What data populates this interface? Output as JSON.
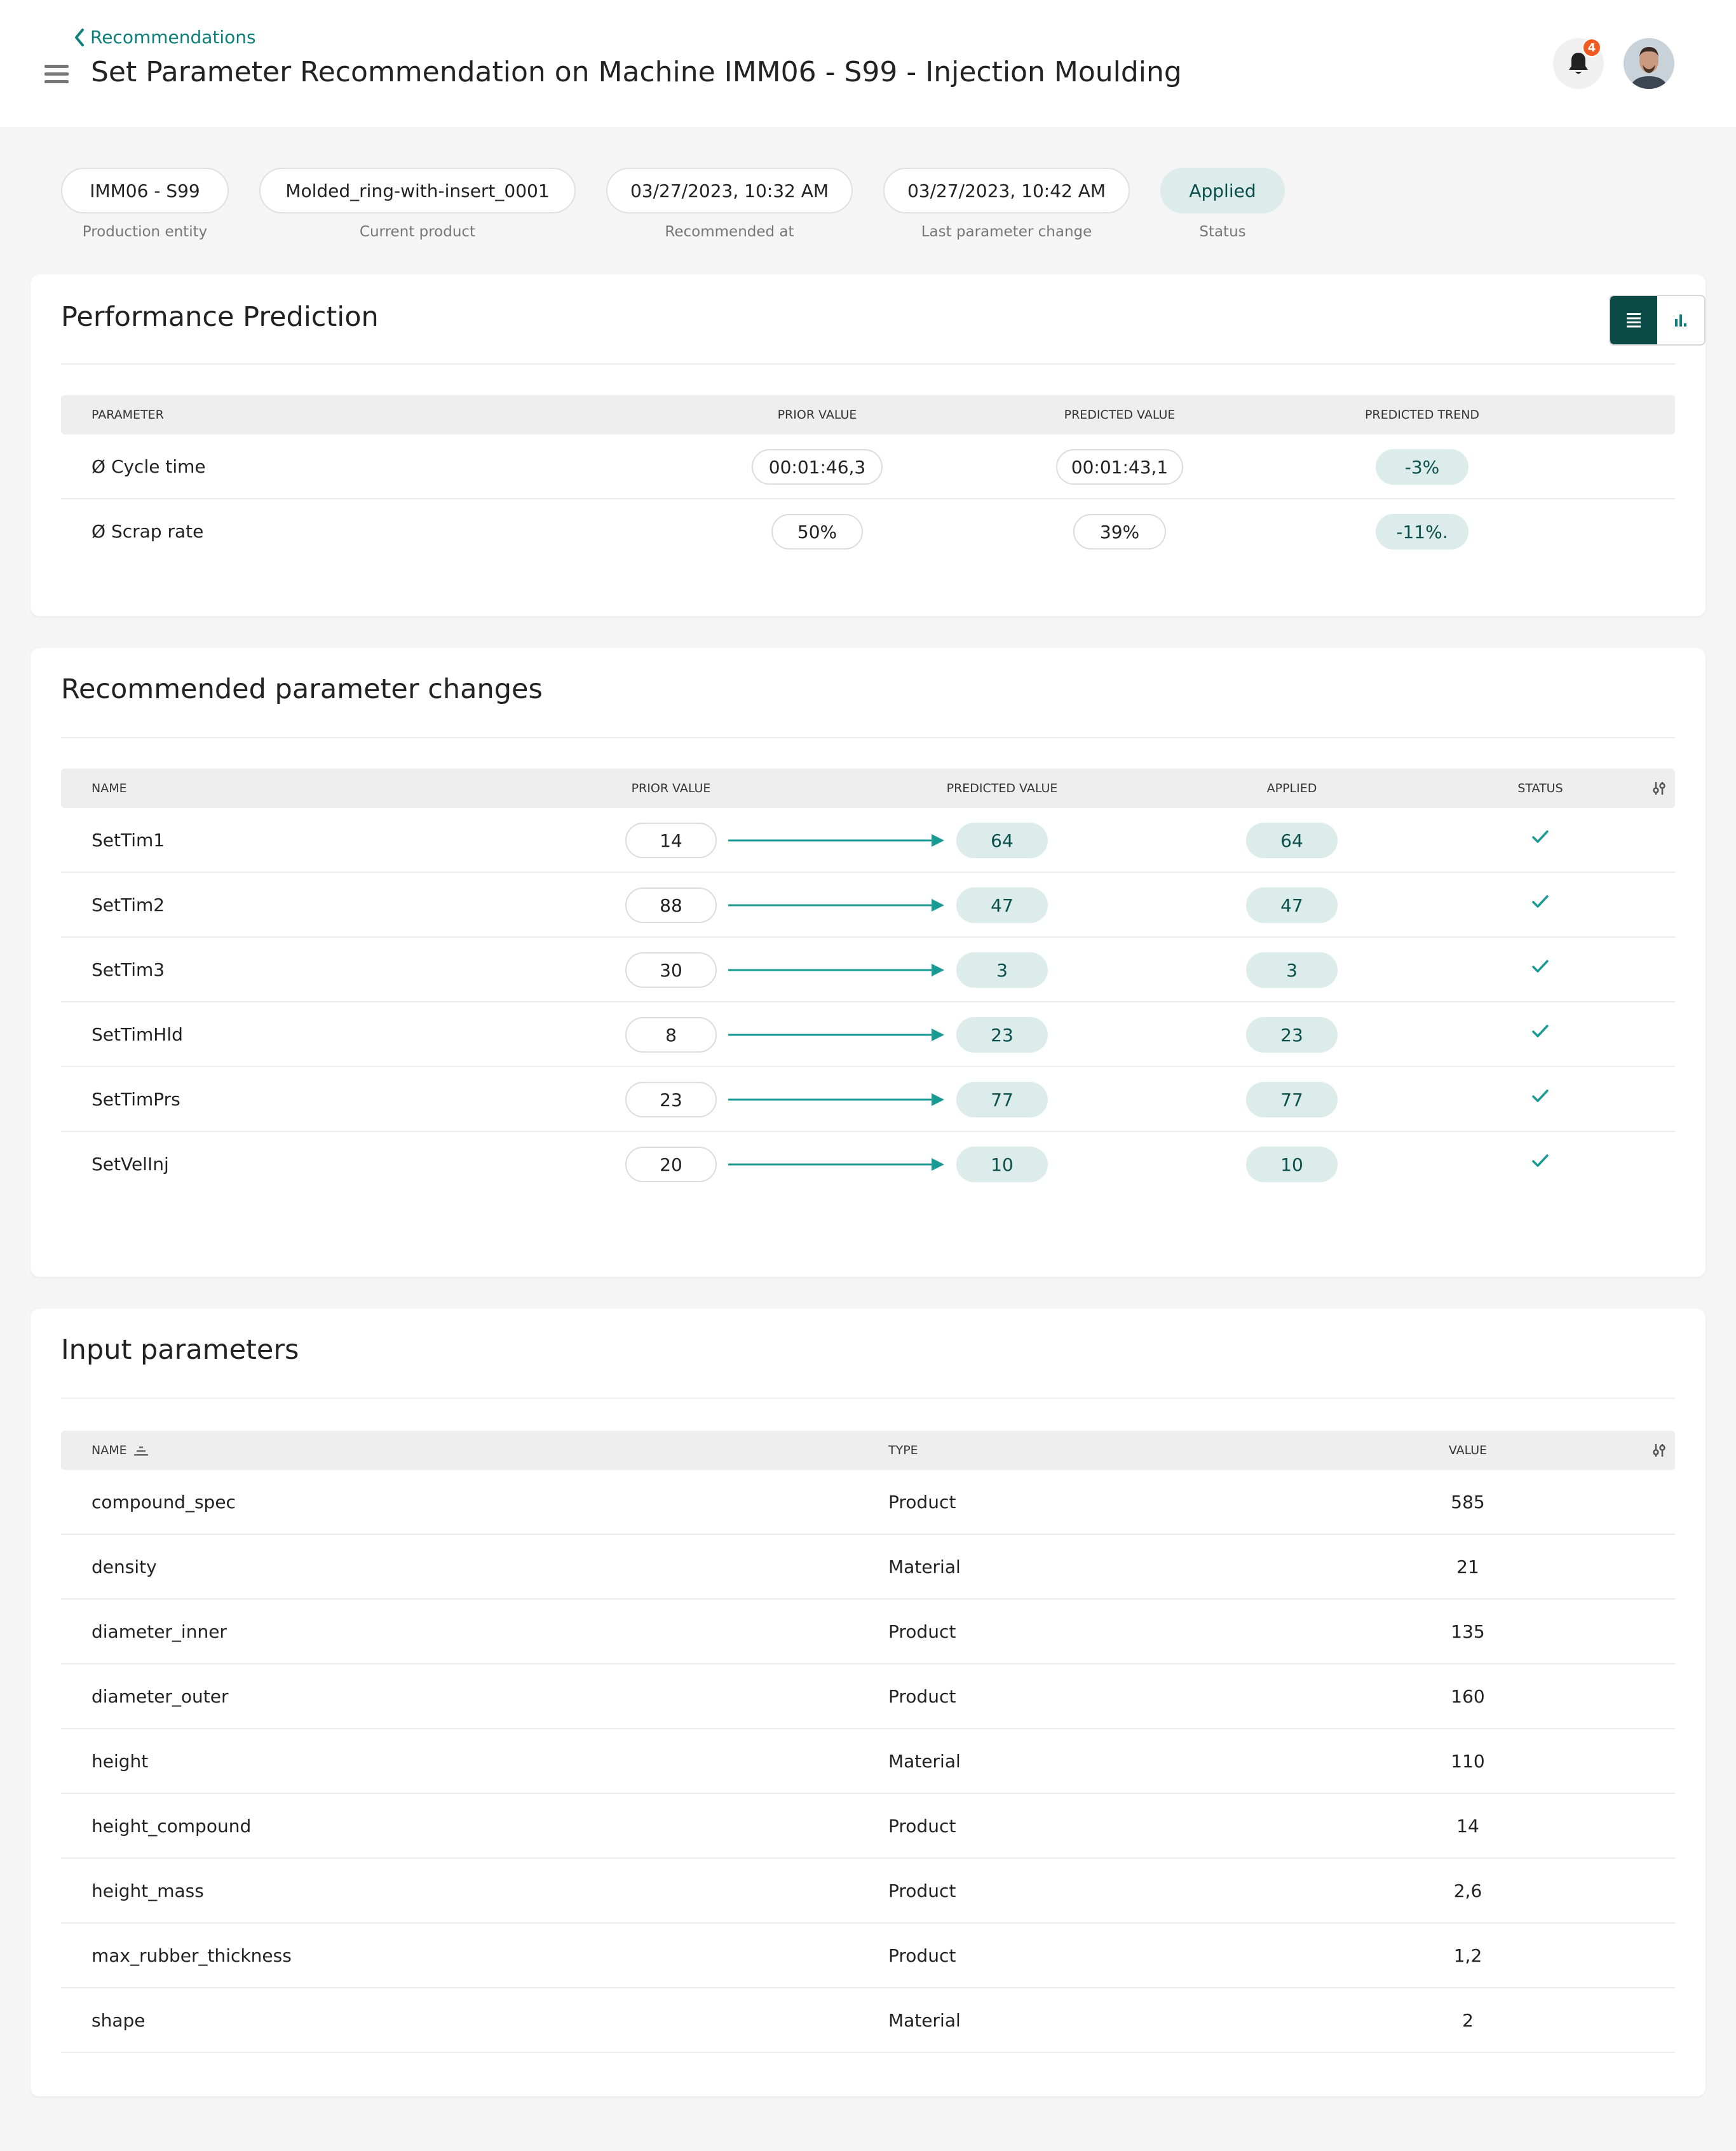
{
  "header": {
    "back_label": "Recommendations",
    "title": "Set Parameter Recommendation on Machine IMM06 - S99 - Injection Moulding",
    "notification_count": "4"
  },
  "info": [
    {
      "value": "IMM06 - S99",
      "label": "Production entity"
    },
    {
      "value": "Molded_ring-with-insert_0001",
      "label": "Current product"
    },
    {
      "value": "03/27/2023, 10:32 AM",
      "label": "Recommended at"
    },
    {
      "value": "03/27/2023, 10:42 AM",
      "label": "Last parameter change"
    },
    {
      "value": "Applied",
      "label": "Status"
    }
  ],
  "performance": {
    "title": "Performance Prediction",
    "columns": [
      "PARAMETER",
      "PRIOR VALUE",
      "PREDICTED VALUE",
      "PREDICTED TREND"
    ],
    "rows": [
      {
        "parameter": "Ø Cycle time",
        "prior": "00:01:46,3",
        "predicted": "00:01:43,1",
        "trend": "-3%"
      },
      {
        "parameter": "Ø Scrap rate",
        "prior": "50%",
        "predicted": "39%",
        "trend": "-11%."
      }
    ]
  },
  "recommended": {
    "title": "Recommended parameter changes",
    "columns": [
      "NAME",
      "PRIOR VALUE",
      "PREDICTED VALUE",
      "APPLIED",
      "STATUS"
    ],
    "rows": [
      {
        "name": "SetTim1",
        "prior": "14",
        "predicted": "64",
        "applied": "64"
      },
      {
        "name": "SetTim2",
        "prior": "88",
        "predicted": "47",
        "applied": "47"
      },
      {
        "name": "SetTim3",
        "prior": "30",
        "predicted": "3",
        "applied": "3"
      },
      {
        "name": "SetTimHld",
        "prior": "8",
        "predicted": "23",
        "applied": "23"
      },
      {
        "name": "SetTimPrs",
        "prior": "23",
        "predicted": "77",
        "applied": "77"
      },
      {
        "name": "SetVelInj",
        "prior": "20",
        "predicted": "10",
        "applied": "10"
      }
    ]
  },
  "inputs": {
    "title": "Input parameters",
    "columns": [
      "NAME",
      "TYPE",
      "VALUE"
    ],
    "rows": [
      {
        "name": "compound_spec",
        "type": "Product",
        "value": "585"
      },
      {
        "name": "density",
        "type": "Material",
        "value": "21"
      },
      {
        "name": "diameter_inner",
        "type": "Product",
        "value": "135"
      },
      {
        "name": "diameter_outer",
        "type": "Product",
        "value": "160"
      },
      {
        "name": "height",
        "type": "Material",
        "value": "110"
      },
      {
        "name": "height_compound",
        "type": "Product",
        "value": "14"
      },
      {
        "name": "height_mass",
        "type": "Product",
        "value": "2,6"
      },
      {
        "name": "max_rubber_thickness",
        "type": "Product",
        "value": "1,2"
      },
      {
        "name": "shape",
        "type": "Material",
        "value": "2"
      }
    ]
  },
  "colors": {
    "accent": "#0b7f7a",
    "dark_teal": "#0b4a45",
    "teal_bg": "#dcecea",
    "badge": "#ee5a1f"
  },
  "icons": {
    "back": "chevron-left-icon",
    "menu": "hamburger-icon",
    "bell": "bell-icon",
    "check": "check-icon",
    "list_view": "list-icon",
    "chart_view": "bar-chart-icon",
    "column_settings": "column-settings-icon",
    "sort": "sort-icon"
  }
}
